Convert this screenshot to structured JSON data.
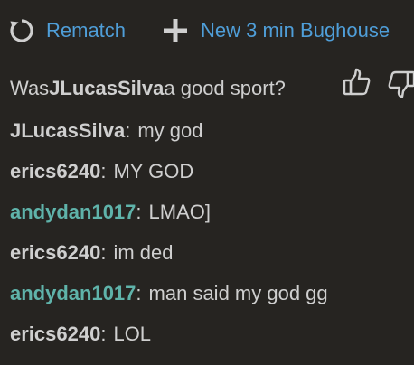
{
  "actions": {
    "rematch_label": "Rematch",
    "new_game_label": "New 3 min Bughouse"
  },
  "sportsmanship": {
    "prefix": "Was ",
    "player": "JLucasSilva",
    "suffix": " a good sport?"
  },
  "chat": {
    "messages": [
      {
        "author": "JLucasSilva",
        "separator": ":",
        "text": "my god"
      },
      {
        "author": "erics6240",
        "separator": ":",
        "text": "MY GOD"
      },
      {
        "author": "andydan1017",
        "separator": ":",
        "text": "LMAO]"
      },
      {
        "author": "erics6240",
        "separator": ":",
        "text": "im ded"
      },
      {
        "author": "andydan1017",
        "separator": ":",
        "text": "man said my god gg"
      },
      {
        "author": "erics6240",
        "separator": ":",
        "text": "LOL"
      }
    ]
  },
  "colors": {
    "background": "#262421",
    "accent_link": "#4f9ed8",
    "text": "#cfcfcf",
    "teammate_name": "#5fb3aa"
  }
}
